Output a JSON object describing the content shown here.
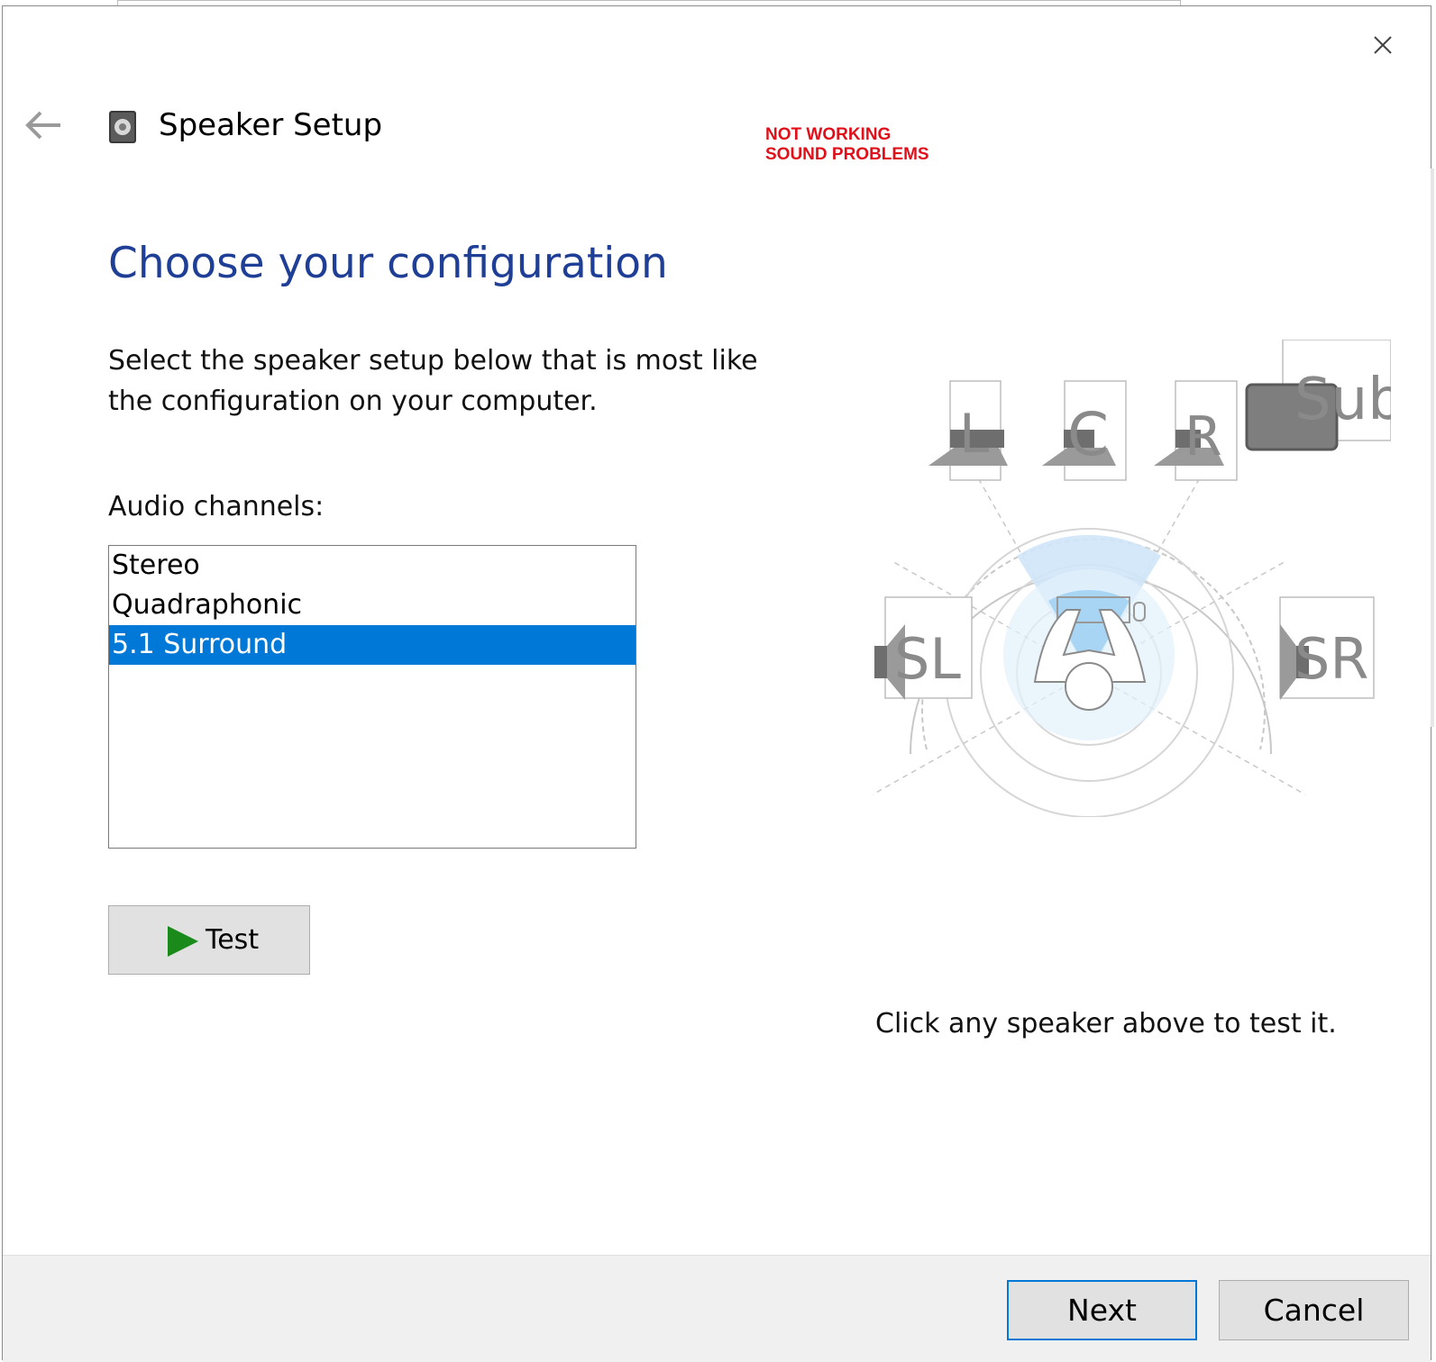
{
  "window": {
    "title": "Speaker Setup",
    "overlay_line1": "NOT WORKING",
    "overlay_line2": "SOUND PROBLEMS"
  },
  "main": {
    "heading": "Choose your configuration",
    "description": "Select the speaker setup below that is most like the configuration on your computer.",
    "channels_label": "Audio channels:",
    "channels": [
      {
        "label": "Stereo",
        "selected": false
      },
      {
        "label": "Quadraphonic",
        "selected": false
      },
      {
        "label": "5.1 Surround",
        "selected": true
      }
    ],
    "test_label": "Test",
    "hint": "Click any speaker above to test it."
  },
  "diagram": {
    "speakers": [
      "L",
      "C",
      "R",
      "Sub",
      "SL",
      "SR"
    ]
  },
  "footer": {
    "next_label": "Next",
    "cancel_label": "Cancel"
  },
  "colors": {
    "heading": "#1f3f97",
    "selection": "#0078d7",
    "overlay": "#e0101b",
    "play": "#1a8a1a"
  },
  "icons": [
    "back-arrow-icon",
    "speaker-app-icon",
    "close-icon",
    "play-icon"
  ]
}
